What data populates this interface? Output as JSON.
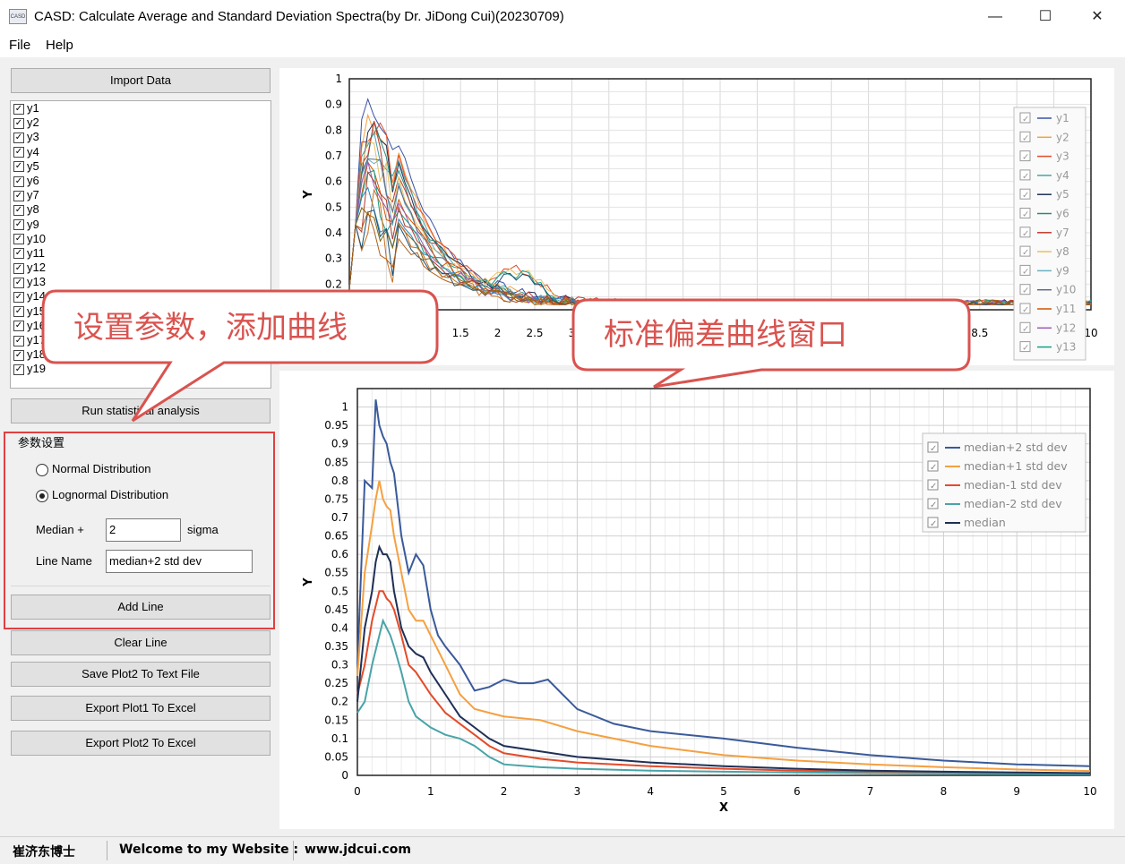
{
  "window": {
    "title": "CASD: Calculate Average and Standard Deviation Spectra(by Dr. JiDong Cui)(20230709)",
    "app_icon_text": "CASD",
    "minimize": "—",
    "maximize": "☐",
    "close": "✕"
  },
  "menu": {
    "file": "File",
    "help": "Help"
  },
  "left": {
    "import_button": "Import Data",
    "list_items": [
      "y1",
      "y2",
      "y3",
      "y4",
      "y5",
      "y6",
      "y7",
      "y8",
      "y9",
      "y10",
      "y11",
      "y12",
      "y13",
      "y14",
      "y15",
      "y16",
      "y17",
      "y18",
      "y19"
    ],
    "run_button": "Run statistical analysis",
    "group_title": "参数设置",
    "radio_normal": "Normal Distribution",
    "radio_lognormal": "Lognormal Distribution",
    "selected_distribution": "Lognormal Distribution",
    "median_label": "Median  +",
    "median_value": "2",
    "sigma_label": "sigma",
    "line_name_label": "Line Name",
    "line_name_value": "median+2 std dev",
    "add_line_button": "Add Line",
    "clear_line_button": "Clear Line",
    "save_plot2_button": "Save Plot2 To Text File",
    "export_plot1_button": "Export Plot1 To Excel",
    "export_plot2_button": "Export Plot2 To Excel"
  },
  "callouts": {
    "params": "设置参数，添加曲线",
    "window": "标准偏差曲线窗口"
  },
  "status": {
    "author": "崔济东博士",
    "welcome": "Welcome to my Website :",
    "url": "www.jdcui.com"
  },
  "chart_data": [
    {
      "type": "line",
      "name": "plot1",
      "ylabel": "Y",
      "xlabel": "",
      "xlim": [
        0,
        10
      ],
      "ylim": [
        0,
        1
      ],
      "yticks": [
        "0.2",
        "0.3",
        "0.4",
        "0.5",
        "0.6",
        "0.7",
        "0.8",
        "0.9",
        "1"
      ],
      "xticks": [
        "1.5",
        "2",
        "2.5",
        "3",
        "8.5",
        "9",
        "9.5",
        "10"
      ],
      "grid": true,
      "legend_position": "right",
      "legend": [
        "y1",
        "y2",
        "y3",
        "y4",
        "y5",
        "y6",
        "y7",
        "y8",
        "y9",
        "y10",
        "y11",
        "y12",
        "y13"
      ],
      "colors": [
        "#3a53a4",
        "#f5a040",
        "#e34b2a",
        "#49a4a8",
        "#1f2f55",
        "#2a8a7a",
        "#c0392b",
        "#e8c060",
        "#6ab0c0",
        "#5a6a8a",
        "#d35400",
        "#9b59b6",
        "#16a085",
        "#b03a2e",
        "#2e86c1",
        "#7d6608",
        "#ca6f1e",
        "#1b4f72",
        "#af601a"
      ],
      "series_note_y_peaks": [
        0.95,
        0.9,
        0.88,
        0.85,
        0.82,
        0.8,
        0.78,
        0.75,
        0.72,
        0.7,
        0.68,
        0.65,
        0.62,
        0.6,
        0.58,
        0.55,
        0.52,
        0.5,
        0.48
      ]
    },
    {
      "type": "line",
      "name": "plot2",
      "xlabel": "X",
      "ylabel": "Y",
      "xlim": [
        0,
        10
      ],
      "ylim": [
        0,
        1.05
      ],
      "xticks": [
        "0",
        "1",
        "2",
        "3",
        "4",
        "5",
        "6",
        "7",
        "8",
        "9",
        "10"
      ],
      "yticks": [
        "0",
        "0.05",
        "0.1",
        "0.15",
        "0.2",
        "0.25",
        "0.3",
        "0.35",
        "0.4",
        "0.45",
        "0.5",
        "0.55",
        "0.6",
        "0.65",
        "0.7",
        "0.75",
        "0.8",
        "0.85",
        "0.9",
        "0.95",
        "1"
      ],
      "grid": true,
      "legend_position": "top-right",
      "series": [
        {
          "name": "median+2 std dev",
          "color": "#3a5a9a",
          "x": [
            0,
            0.1,
            0.2,
            0.25,
            0.3,
            0.35,
            0.4,
            0.45,
            0.5,
            0.6,
            0.7,
            0.8,
            0.9,
            1.0,
            1.1,
            1.2,
            1.4,
            1.6,
            1.8,
            2.0,
            2.2,
            2.4,
            2.6,
            2.8,
            3.0,
            3.5,
            4,
            5,
            6,
            7,
            8,
            9,
            10
          ],
          "y": [
            0.3,
            0.8,
            0.78,
            1.02,
            0.95,
            0.92,
            0.9,
            0.85,
            0.82,
            0.65,
            0.55,
            0.6,
            0.57,
            0.45,
            0.38,
            0.35,
            0.3,
            0.23,
            0.24,
            0.26,
            0.25,
            0.25,
            0.26,
            0.22,
            0.18,
            0.14,
            0.12,
            0.1,
            0.075,
            0.055,
            0.04,
            0.03,
            0.025
          ]
        },
        {
          "name": "median+1 std dev",
          "color": "#f5a040",
          "x": [
            0,
            0.1,
            0.2,
            0.25,
            0.3,
            0.35,
            0.4,
            0.45,
            0.5,
            0.6,
            0.7,
            0.8,
            0.9,
            1.0,
            1.2,
            1.4,
            1.6,
            1.8,
            2.0,
            2.5,
            3.0,
            3.5,
            4,
            5,
            6,
            7,
            8,
            9,
            10
          ],
          "y": [
            0.27,
            0.55,
            0.68,
            0.75,
            0.8,
            0.75,
            0.73,
            0.72,
            0.65,
            0.55,
            0.45,
            0.42,
            0.42,
            0.38,
            0.3,
            0.22,
            0.18,
            0.17,
            0.16,
            0.15,
            0.12,
            0.1,
            0.08,
            0.055,
            0.04,
            0.03,
            0.022,
            0.016,
            0.012
          ]
        },
        {
          "name": "median-1 std dev",
          "color": "#e34b2a",
          "x": [
            0,
            0.1,
            0.2,
            0.3,
            0.35,
            0.4,
            0.45,
            0.5,
            0.6,
            0.7,
            0.8,
            1.0,
            1.2,
            1.4,
            1.6,
            1.8,
            2.0,
            2.5,
            3.0,
            4,
            5,
            6,
            7,
            8,
            9,
            10
          ],
          "y": [
            0.22,
            0.3,
            0.42,
            0.5,
            0.5,
            0.48,
            0.47,
            0.45,
            0.38,
            0.3,
            0.28,
            0.22,
            0.17,
            0.14,
            0.11,
            0.08,
            0.06,
            0.045,
            0.035,
            0.025,
            0.018,
            0.013,
            0.01,
            0.008,
            0.006,
            0.005
          ]
        },
        {
          "name": "median-2 std dev",
          "color": "#49a4a8",
          "x": [
            0,
            0.1,
            0.2,
            0.3,
            0.35,
            0.4,
            0.45,
            0.5,
            0.6,
            0.7,
            0.8,
            1.0,
            1.2,
            1.4,
            1.6,
            1.8,
            2.0,
            2.5,
            3.0,
            4,
            5,
            6,
            7,
            8,
            9,
            10
          ],
          "y": [
            0.17,
            0.2,
            0.3,
            0.38,
            0.42,
            0.4,
            0.38,
            0.35,
            0.28,
            0.2,
            0.16,
            0.13,
            0.11,
            0.1,
            0.08,
            0.05,
            0.03,
            0.022,
            0.018,
            0.013,
            0.01,
            0.008,
            0.006,
            0.005,
            0.004,
            0.003
          ]
        },
        {
          "name": "median",
          "color": "#1f2f55",
          "x": [
            0,
            0.1,
            0.2,
            0.25,
            0.3,
            0.35,
            0.4,
            0.45,
            0.5,
            0.6,
            0.7,
            0.8,
            0.9,
            1.0,
            1.2,
            1.4,
            1.6,
            1.8,
            2.0,
            2.5,
            3.0,
            4,
            5,
            6,
            7,
            8,
            9,
            10
          ],
          "y": [
            0.2,
            0.4,
            0.5,
            0.58,
            0.62,
            0.6,
            0.6,
            0.58,
            0.5,
            0.4,
            0.35,
            0.33,
            0.32,
            0.28,
            0.22,
            0.16,
            0.13,
            0.1,
            0.08,
            0.065,
            0.05,
            0.035,
            0.025,
            0.018,
            0.013,
            0.01,
            0.008,
            0.006
          ]
        }
      ]
    }
  ]
}
